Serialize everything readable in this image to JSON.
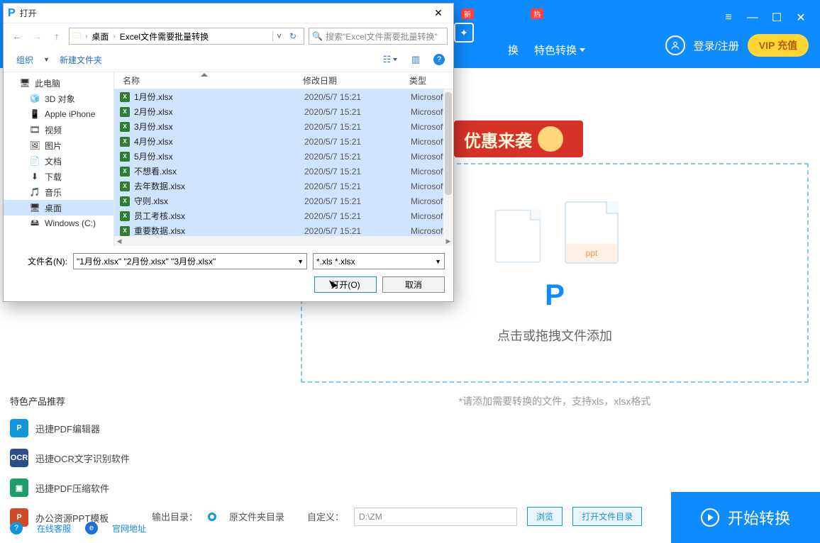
{
  "app": {
    "tabs": {
      "convert": "换",
      "special": "特色转换"
    },
    "badges": {
      "new": "新",
      "hot": "热"
    },
    "login": "登录/注册",
    "vip": "VIP 充值",
    "promo": "优惠来袭",
    "drop_text": "点击或拖拽文件添加",
    "drop_hint": "*请添加需要转换的文件，支持xls，xlsx格式",
    "doc_label_ppt": "ppt",
    "recommend_title": "特色产品推荐",
    "recommend": [
      {
        "name": "迅捷PDF编辑器",
        "color": "#1296db",
        "tag": "P"
      },
      {
        "name": "迅捷OCR文字识别软件",
        "color": "#2b4f8e",
        "tag": "OCR"
      },
      {
        "name": "迅捷PDF压缩软件",
        "color": "#1e9e6a",
        "tag": "▣"
      },
      {
        "name": "办公资源PPT模板",
        "color": "#d04a2a",
        "tag": "P"
      }
    ],
    "footer": {
      "chat": "在线客服",
      "link": "官网地址"
    },
    "output": {
      "label": "输出目录：",
      "mode": "原文件夹目录",
      "custom_label": "自定义：",
      "custom_value": "D:\\ZM",
      "browse": "浏览",
      "open_folder": "打开文件目录"
    },
    "start": "开始转换"
  },
  "dialog": {
    "title": "打开",
    "crumb1": "桌面",
    "crumb2": "Excel文件需要批量转换",
    "search_placeholder": "搜索\"Excel文件需要批量转换\"",
    "organize": "组织",
    "new_folder": "新建文件夹",
    "columns": {
      "name": "名称",
      "date": "修改日期",
      "type": "类型"
    },
    "tree": [
      {
        "label": "此电脑",
        "icon": "pc",
        "level": 0
      },
      {
        "label": "3D 对象",
        "icon": "3d",
        "level": 1
      },
      {
        "label": "Apple iPhone",
        "icon": "phone",
        "level": 1
      },
      {
        "label": "视频",
        "icon": "video",
        "level": 1
      },
      {
        "label": "图片",
        "icon": "image",
        "level": 1
      },
      {
        "label": "文档",
        "icon": "doc",
        "level": 1
      },
      {
        "label": "下载",
        "icon": "down",
        "level": 1
      },
      {
        "label": "音乐",
        "icon": "music",
        "level": 1
      },
      {
        "label": "桌面",
        "icon": "desktop",
        "level": 1,
        "selected": true
      },
      {
        "label": "Windows (C:)",
        "icon": "drive",
        "level": 1
      }
    ],
    "files": [
      {
        "name": "1月份.xlsx",
        "date": "2020/5/7 15:21",
        "type": "Microsoft"
      },
      {
        "name": "2月份.xlsx",
        "date": "2020/5/7 15:21",
        "type": "Microsoft"
      },
      {
        "name": "3月份.xlsx",
        "date": "2020/5/7 15:21",
        "type": "Microsoft"
      },
      {
        "name": "4月份.xlsx",
        "date": "2020/5/7 15:21",
        "type": "Microsoft"
      },
      {
        "name": "5月份.xlsx",
        "date": "2020/5/7 15:21",
        "type": "Microsoft"
      },
      {
        "name": "不想看.xlsx",
        "date": "2020/5/7 15:21",
        "type": "Microsoft"
      },
      {
        "name": "去年数据.xlsx",
        "date": "2020/5/7 15:21",
        "type": "Microsoft"
      },
      {
        "name": "守则.xlsx",
        "date": "2020/5/7 15:21",
        "type": "Microsoft"
      },
      {
        "name": "员工考核.xlsx",
        "date": "2020/5/7 15:21",
        "type": "Microsoft"
      },
      {
        "name": "重要数据.xlsx",
        "date": "2020/5/7 15:21",
        "type": "Microsoft"
      }
    ],
    "filename_label": "文件名(N):",
    "filename_value": "\"1月份.xlsx\" \"2月份.xlsx\" \"3月份.xlsx\"",
    "filter": "*.xls *.xlsx",
    "open_btn": "打开(O)",
    "cancel_btn": "取消"
  }
}
